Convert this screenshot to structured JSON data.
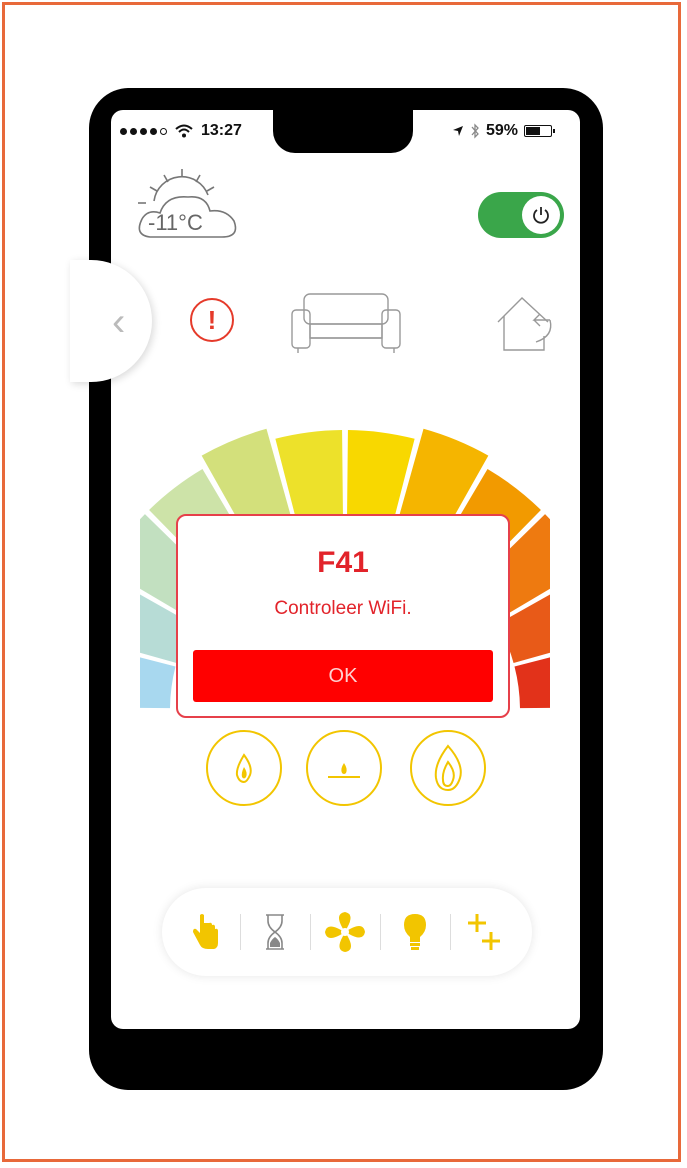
{
  "status_bar": {
    "time": "13:27",
    "battery": "59%",
    "signal_dots_filled": 4,
    "signal_dots_total": 5
  },
  "weather": {
    "temperature": "-11°C",
    "icon": "sun-cloud-icon"
  },
  "power_toggle": {
    "state": "on",
    "icon": "power-icon"
  },
  "nav": {
    "back_icon": "chevron-left-icon",
    "alert_icon": "exclamation-icon",
    "center_icon": "sofa-icon",
    "right_icon": "home-return-icon"
  },
  "gauge": {
    "segment_colors": [
      "#a8d8ef",
      "#b7dcd6",
      "#c2e0c0",
      "#cde3a8",
      "#d3e07b",
      "#ede12a",
      "#f8d800",
      "#f5b500",
      "#f29a00",
      "#ee7a10",
      "#e85a18",
      "#e2321a"
    ]
  },
  "dialog": {
    "code": "F41",
    "message": "Controleer  WiFi.",
    "ok_label": "OK"
  },
  "flame_buttons": [
    "flame-low-icon",
    "flame-pilot-icon",
    "flame-high-icon"
  ],
  "toolbar": {
    "items": [
      "hand-icon",
      "hourglass-icon",
      "fan-icon",
      "bulb-icon",
      "plus-plus-icon"
    ]
  },
  "colors": {
    "accent_yellow": "#f2c500",
    "alert_red": "#e2232a",
    "ok_red": "#ff0000",
    "toggle_green": "#3aa64a",
    "frame_orange": "#e8693a"
  }
}
